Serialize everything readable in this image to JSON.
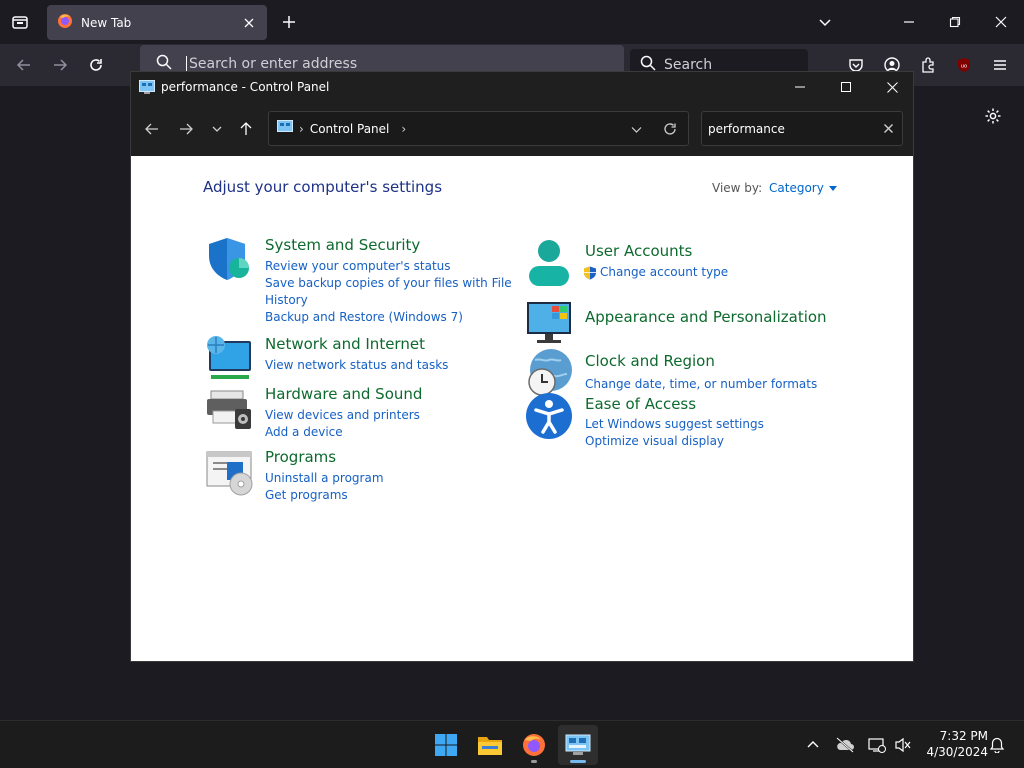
{
  "browser": {
    "tab_title": "New Tab",
    "url_placeholder": "Search or enter address",
    "search_placeholder": "Search"
  },
  "window": {
    "title": "performance - Control Panel",
    "breadcrumb": "Control Panel",
    "search_value": "performance"
  },
  "content": {
    "heading": "Adjust your computer's settings",
    "view_by_label": "View by:",
    "view_by_value": "Category"
  },
  "categories": [
    {
      "title": "System and Security",
      "icon": "shield-icon",
      "links": [
        "Review your computer's status",
        "Save backup copies of your files with File",
        "History",
        "Backup and Restore (Windows 7)"
      ]
    },
    {
      "title": "Network and Internet",
      "icon": "network-icon",
      "links": [
        "View network status and tasks"
      ]
    },
    {
      "title": "Hardware and Sound",
      "icon": "printer-icon",
      "links": [
        "View devices and printers",
        "Add a device"
      ]
    },
    {
      "title": "Programs",
      "icon": "programs-icon",
      "links": [
        "Uninstall a program",
        "Get programs"
      ]
    },
    {
      "title": "User Accounts",
      "icon": "user-icon",
      "links": [
        "Change account type"
      ]
    },
    {
      "title": "Appearance and Personalization",
      "icon": "monitor-icon",
      "links": []
    },
    {
      "title": "Clock and Region",
      "icon": "clock-globe-icon",
      "links": [
        "Change date, time, or number formats"
      ]
    },
    {
      "title": "Ease of Access",
      "icon": "accessibility-icon",
      "links": [
        "Let Windows suggest settings",
        "Optimize visual display"
      ]
    }
  ],
  "taskbar": {
    "time": "7:32 PM",
    "date": "4/30/2024"
  },
  "colors": {
    "link": "#1660c4",
    "category_title": "#0d6a2e",
    "heading": "#1e3287",
    "titlebar": "#1f1f1f"
  }
}
